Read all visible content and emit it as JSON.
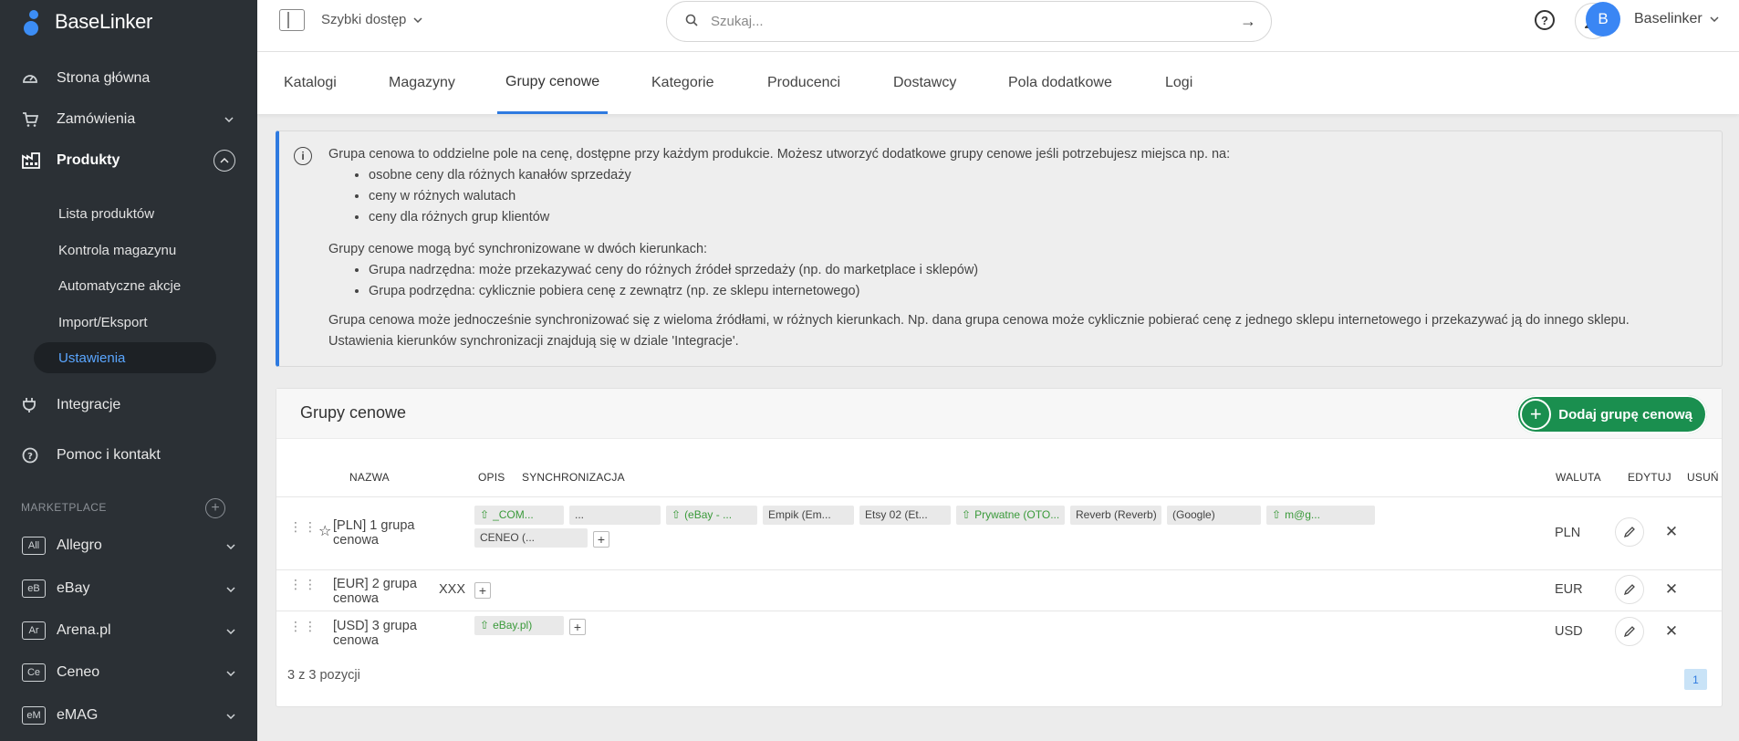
{
  "brand": {
    "name": "BaseLinker",
    "accent": "#3c8df5"
  },
  "sidebar": {
    "items": [
      {
        "label": "Strona główna",
        "icon": "dashboard-icon"
      },
      {
        "label": "Zamówienia",
        "icon": "cart-icon"
      },
      {
        "label": "Produkty",
        "icon": "products-icon"
      },
      {
        "label": "Integracje",
        "icon": "plug-icon"
      },
      {
        "label": "Pomoc i kontakt",
        "icon": "help-icon"
      }
    ],
    "subitems": [
      "Lista produktów",
      "Kontrola magazynu",
      "Automatyczne akcje",
      "Import/Eksport",
      "Ustawienia"
    ],
    "marketplace_label": "MARKETPLACE",
    "marketplaces": [
      {
        "badge": "All",
        "label": "Allegro"
      },
      {
        "badge": "eB",
        "label": "eBay"
      },
      {
        "badge": "Ar",
        "label": "Arena.pl"
      },
      {
        "badge": "Ce",
        "label": "Ceneo"
      },
      {
        "badge": "eM",
        "label": "eMAG"
      }
    ]
  },
  "topbar": {
    "quick_access": "Szybki dostęp",
    "search_placeholder": "Szukaj...",
    "avatar_letter": "B",
    "user_name": "Baselinker"
  },
  "tabs": [
    "Katalogi",
    "Magazyny",
    "Grupy cenowe",
    "Kategorie",
    "Producenci",
    "Dostawcy",
    "Pola dodatkowe",
    "Logi"
  ],
  "info": {
    "intro": "Grupa cenowa to oddzielne pole na cenę, dostępne przy każdym produkcie. Możesz utworzyć dodatkowe grupy cenowe jeśli potrzebujesz miejsca np. na:",
    "list1": [
      "osobne ceny dla różnych kanałów sprzedaży",
      "ceny w różnych walutach",
      "ceny dla różnych grup klientów"
    ],
    "sync_intro": "Grupy cenowe mogą być synchronizowane w dwóch kierunkach:",
    "list2": [
      "Grupa nadrzędna: może przekazywać ceny do różnych źródeł sprzedaży (np. do marketplace i sklepów)",
      "Grupa podrzędna: cyklicznie pobiera cenę z zewnątrz (np. ze sklepu internetowego)"
    ],
    "footer1": "Grupa cenowa może jednocześnie synchronizować się z wieloma źródłami, w różnych kierunkach. Np. dana grupa cenowa może cyklicznie pobierać cenę z jednego sklepu internetowego i przekazywać ją do innego sklepu.",
    "footer2": "Ustawienia kierunków synchronizacji znajdują się w dziale 'Integracje'."
  },
  "card": {
    "title": "Grupy cenowe",
    "add_button": "Dodaj grupę cenową",
    "headers": {
      "name": "NAZWA",
      "desc": "OPIS",
      "sync": "SYNCHRONIZACJA",
      "currency": "WALUTA",
      "edit": "EDYTUJ",
      "delete": "USUŃ"
    },
    "rows": [
      {
        "name": "[PLN] 1 grupa cenowa",
        "desc": "",
        "currency": "PLN",
        "tags": [
          {
            "text": "_COM...",
            "green": true
          },
          {
            "text": "...",
            "green": false
          },
          {
            "text": "(eBay - ...",
            "green": true
          },
          {
            "text": "Empik (Em...",
            "green": false
          },
          {
            "text": "Etsy 02 (Et...",
            "green": false
          },
          {
            "text": "Prywatne (OTO...",
            "green": true
          },
          {
            "text": "Reverb (Reverb)",
            "green": false
          },
          {
            "text": "(Google)",
            "green": false
          },
          {
            "text": "m@g...",
            "green": true
          },
          {
            "text": "CENEO (...",
            "green": false
          }
        ]
      },
      {
        "name": "[EUR] 2 grupa cenowa",
        "desc": "XXX",
        "currency": "EUR",
        "tags": []
      },
      {
        "name": "[USD] 3 grupa cenowa",
        "desc": "",
        "currency": "USD",
        "tags": [
          {
            "text": "eBay.pl)",
            "green": true
          }
        ]
      }
    ],
    "count_text": "3 z 3 pozycji",
    "page": "1"
  }
}
